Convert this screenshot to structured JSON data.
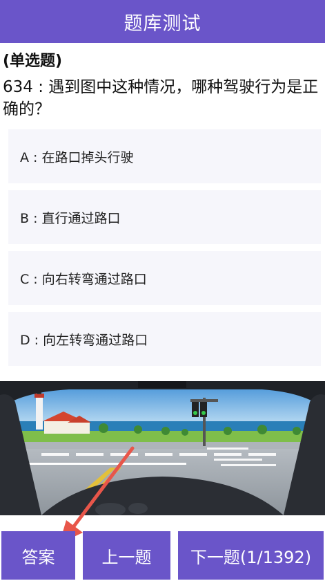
{
  "header": {
    "title": "题库测试"
  },
  "question": {
    "type_label": "(单选题)",
    "text": " 634 : 遇到图中这种情况，哪种驾驶行为是正确的？"
  },
  "options": [
    {
      "label": "A : 在路口掉头行驶"
    },
    {
      "label": "B : 直行通过路口"
    },
    {
      "label": "C : 向右转弯通过路口"
    },
    {
      "label": "D : 向左转弯通过路口"
    }
  ],
  "buttons": {
    "answer": "答案",
    "prev": "上一题",
    "next": "下一题(1/1392)"
  },
  "colors": {
    "accent": "#6a55c9",
    "option_bg": "#f6f6fb",
    "annotation_arrow": "#e8564a"
  },
  "icons": {
    "annotation": "red-arrow-pointing-to-answer-button"
  }
}
